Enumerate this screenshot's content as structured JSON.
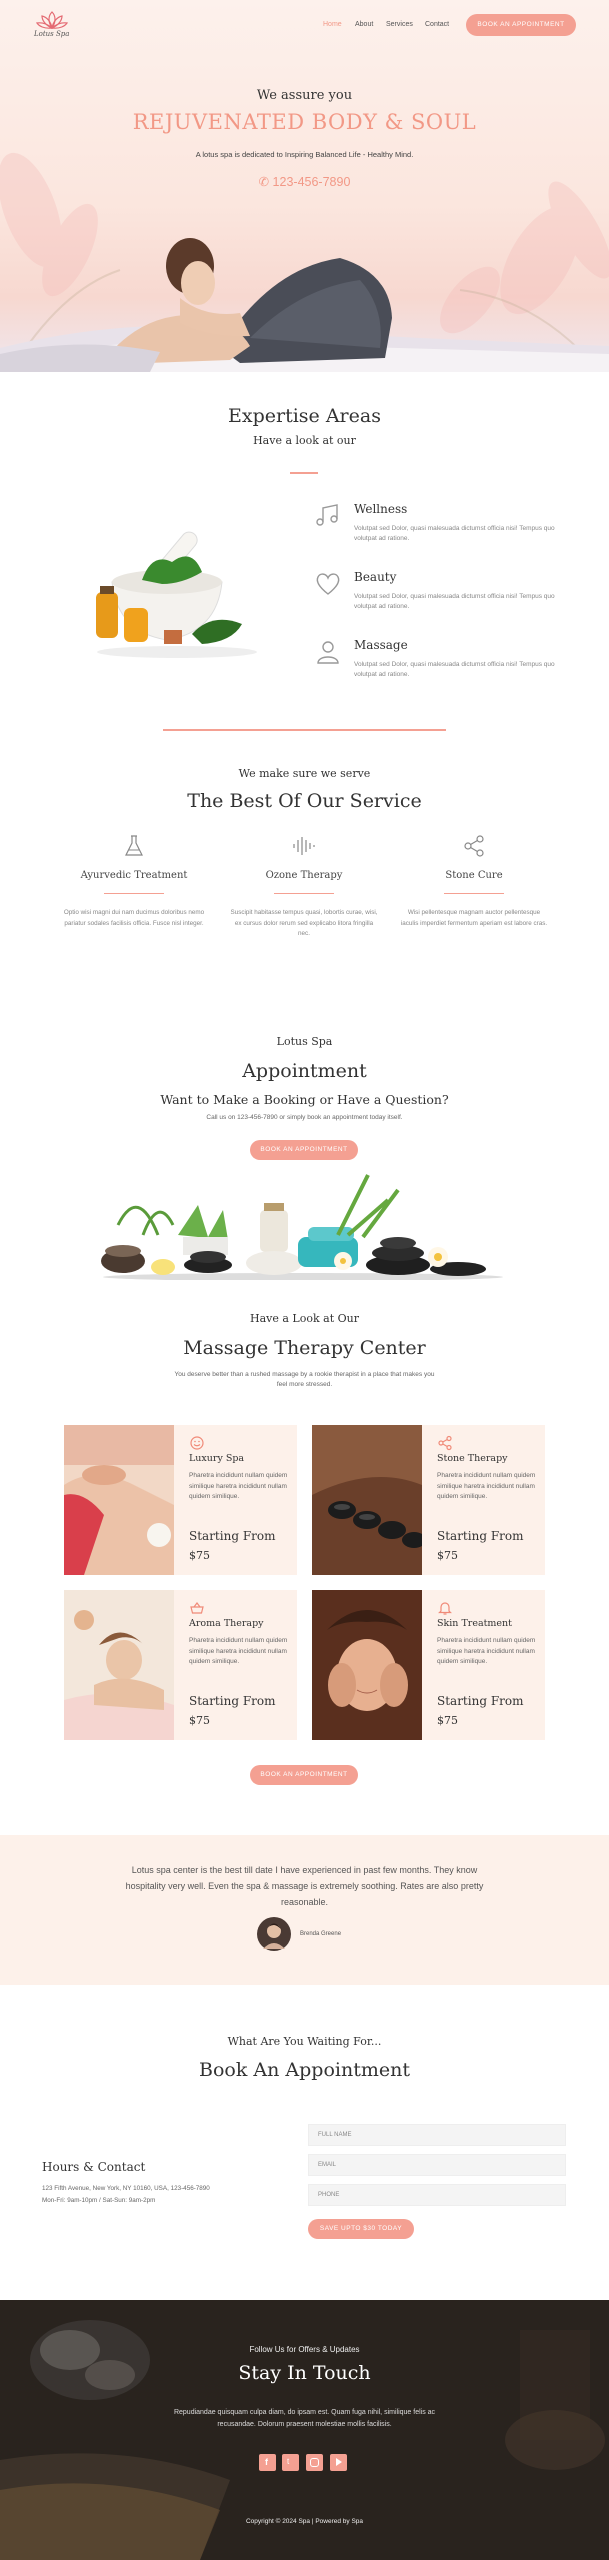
{
  "nav": {
    "logo_text": "Lotus Spa",
    "links": [
      "Home",
      "About",
      "Services",
      "Contact"
    ],
    "cta": "BOOK AN APPOINTMENT"
  },
  "hero": {
    "kicker": "We assure you",
    "title": "REJUVENATED BODY & SOUL",
    "subtitle": "A lotus spa is dedicated to Inspiring Balanced Life - Healthy Mind.",
    "phone": "123-456-7890"
  },
  "expertise": {
    "title": "Expertise Areas",
    "subtitle": "Have a look at our",
    "items": [
      {
        "icon": "music-note-icon",
        "title": "Wellness",
        "text": "Volutpat sed Dolor, quasi malesuada dictumst officia nisi! Tempus quo volutpat ad ratione."
      },
      {
        "icon": "heart-icon",
        "title": "Beauty",
        "text": "Volutpat sed Dolor, quasi malesuada dictumst officia nisi! Tempus quo volutpat ad ratione."
      },
      {
        "icon": "person-icon",
        "title": "Massage",
        "text": "Volutpat sed Dolor, quasi malesuada dictumst officia nisi! Tempus quo volutpat ad ratione."
      }
    ]
  },
  "service": {
    "kicker": "We make sure we serve",
    "title": "The Best Of Our Service",
    "items": [
      {
        "icon": "flask-icon",
        "title": "Ayurvedic Treatment",
        "text": "Optio wisi magni dui nam ducimus doloribus nemo pariatur sodales facilisis officia. Fusce nisl integer."
      },
      {
        "icon": "waveform-icon",
        "title": "Ozone Therapy",
        "text": "Suscipit habitasse tempus quasi, lobortis curae, wisi, ex cursus dolor rerum sed explicabo litora fringilla nec."
      },
      {
        "icon": "share-icon",
        "title": "Stone Cure",
        "text": "Wisi pellentesque magnam auctor pellentesque iaculis imperdiet fermentum aperiam est labore cras."
      }
    ]
  },
  "appointment": {
    "brand": "Lotus Spa",
    "title": "Appointment",
    "question": "Want to Make a Booking or Have a Question?",
    "text": "Call us on 123-456-7890 or simply book an appointment today itself.",
    "cta": "BOOK AN APPOINTMENT"
  },
  "center": {
    "kicker": "Have a Look at Our",
    "title": "Massage Therapy Center",
    "text": "You deserve better than a rushed massage by a rookie therapist in a place that makes you feel more stressed.",
    "cards": [
      {
        "icon": "smile-icon",
        "title": "Luxury Spa",
        "text": "Pharetra incididunt nullam quidem similique haretra incididunt nullam quidem similique.",
        "starting": "Starting From",
        "price": "$75"
      },
      {
        "icon": "share-icon",
        "title": "Stone Therapy",
        "text": "Pharetra incididunt nullam quidem similique haretra incididunt nullam quidem similique.",
        "starting": "Starting From",
        "price": "$75"
      },
      {
        "icon": "basket-icon",
        "title": "Aroma Therapy",
        "text": "Pharetra incididunt nullam quidem similique haretra incididunt nullam quidem similique.",
        "starting": "Starting From",
        "price": "$75"
      },
      {
        "icon": "bell-icon",
        "title": "Skin Treatment",
        "text": "Pharetra incididunt nullam quidem similique haretra incididunt nullam quidem similique.",
        "starting": "Starting From",
        "price": "$75"
      }
    ],
    "cta": "BOOK AN APPOINTMENT"
  },
  "testimonial": {
    "quote": "Lotus spa center is the best till date I have experienced in past few months. They know hospitality very well. Even the spa & massage is extremely soothing. Rates are also pretty reasonable.",
    "author": "Brenda Greene"
  },
  "booking": {
    "kicker": "What Are You Waiting For...",
    "title": "Book An Appointment",
    "contact_title": "Hours & Contact",
    "address": "123 Fifth Avenue, New York, NY 10160, USA, 123-456-7890",
    "hours": "Mon-Fri: 9am-10pm / Sat-Sun: 9am-2pm",
    "fields": {
      "name": "FULL NAME",
      "email": "EMAIL",
      "phone": "PHONE"
    },
    "submit": "SAVE UPTO $30 TODAY"
  },
  "footer": {
    "kicker": "Follow Us for Offers & Updates",
    "title": "Stay In Touch",
    "text": "Repudiandae quisquam culpa diam, do ipsam est. Quam fuga nihil, similique felis ac recusandae. Dolorum praesent molestiae mollis facilisis.",
    "social": [
      "facebook-icon",
      "twitter-icon",
      "instagram-icon",
      "youtube-icon"
    ],
    "copyright": "Copyright © 2024 Spa | Powered by Spa"
  },
  "colors": {
    "accent": "#f4a092",
    "accent_text": "#f29886",
    "cream": "#fdf1ea"
  }
}
